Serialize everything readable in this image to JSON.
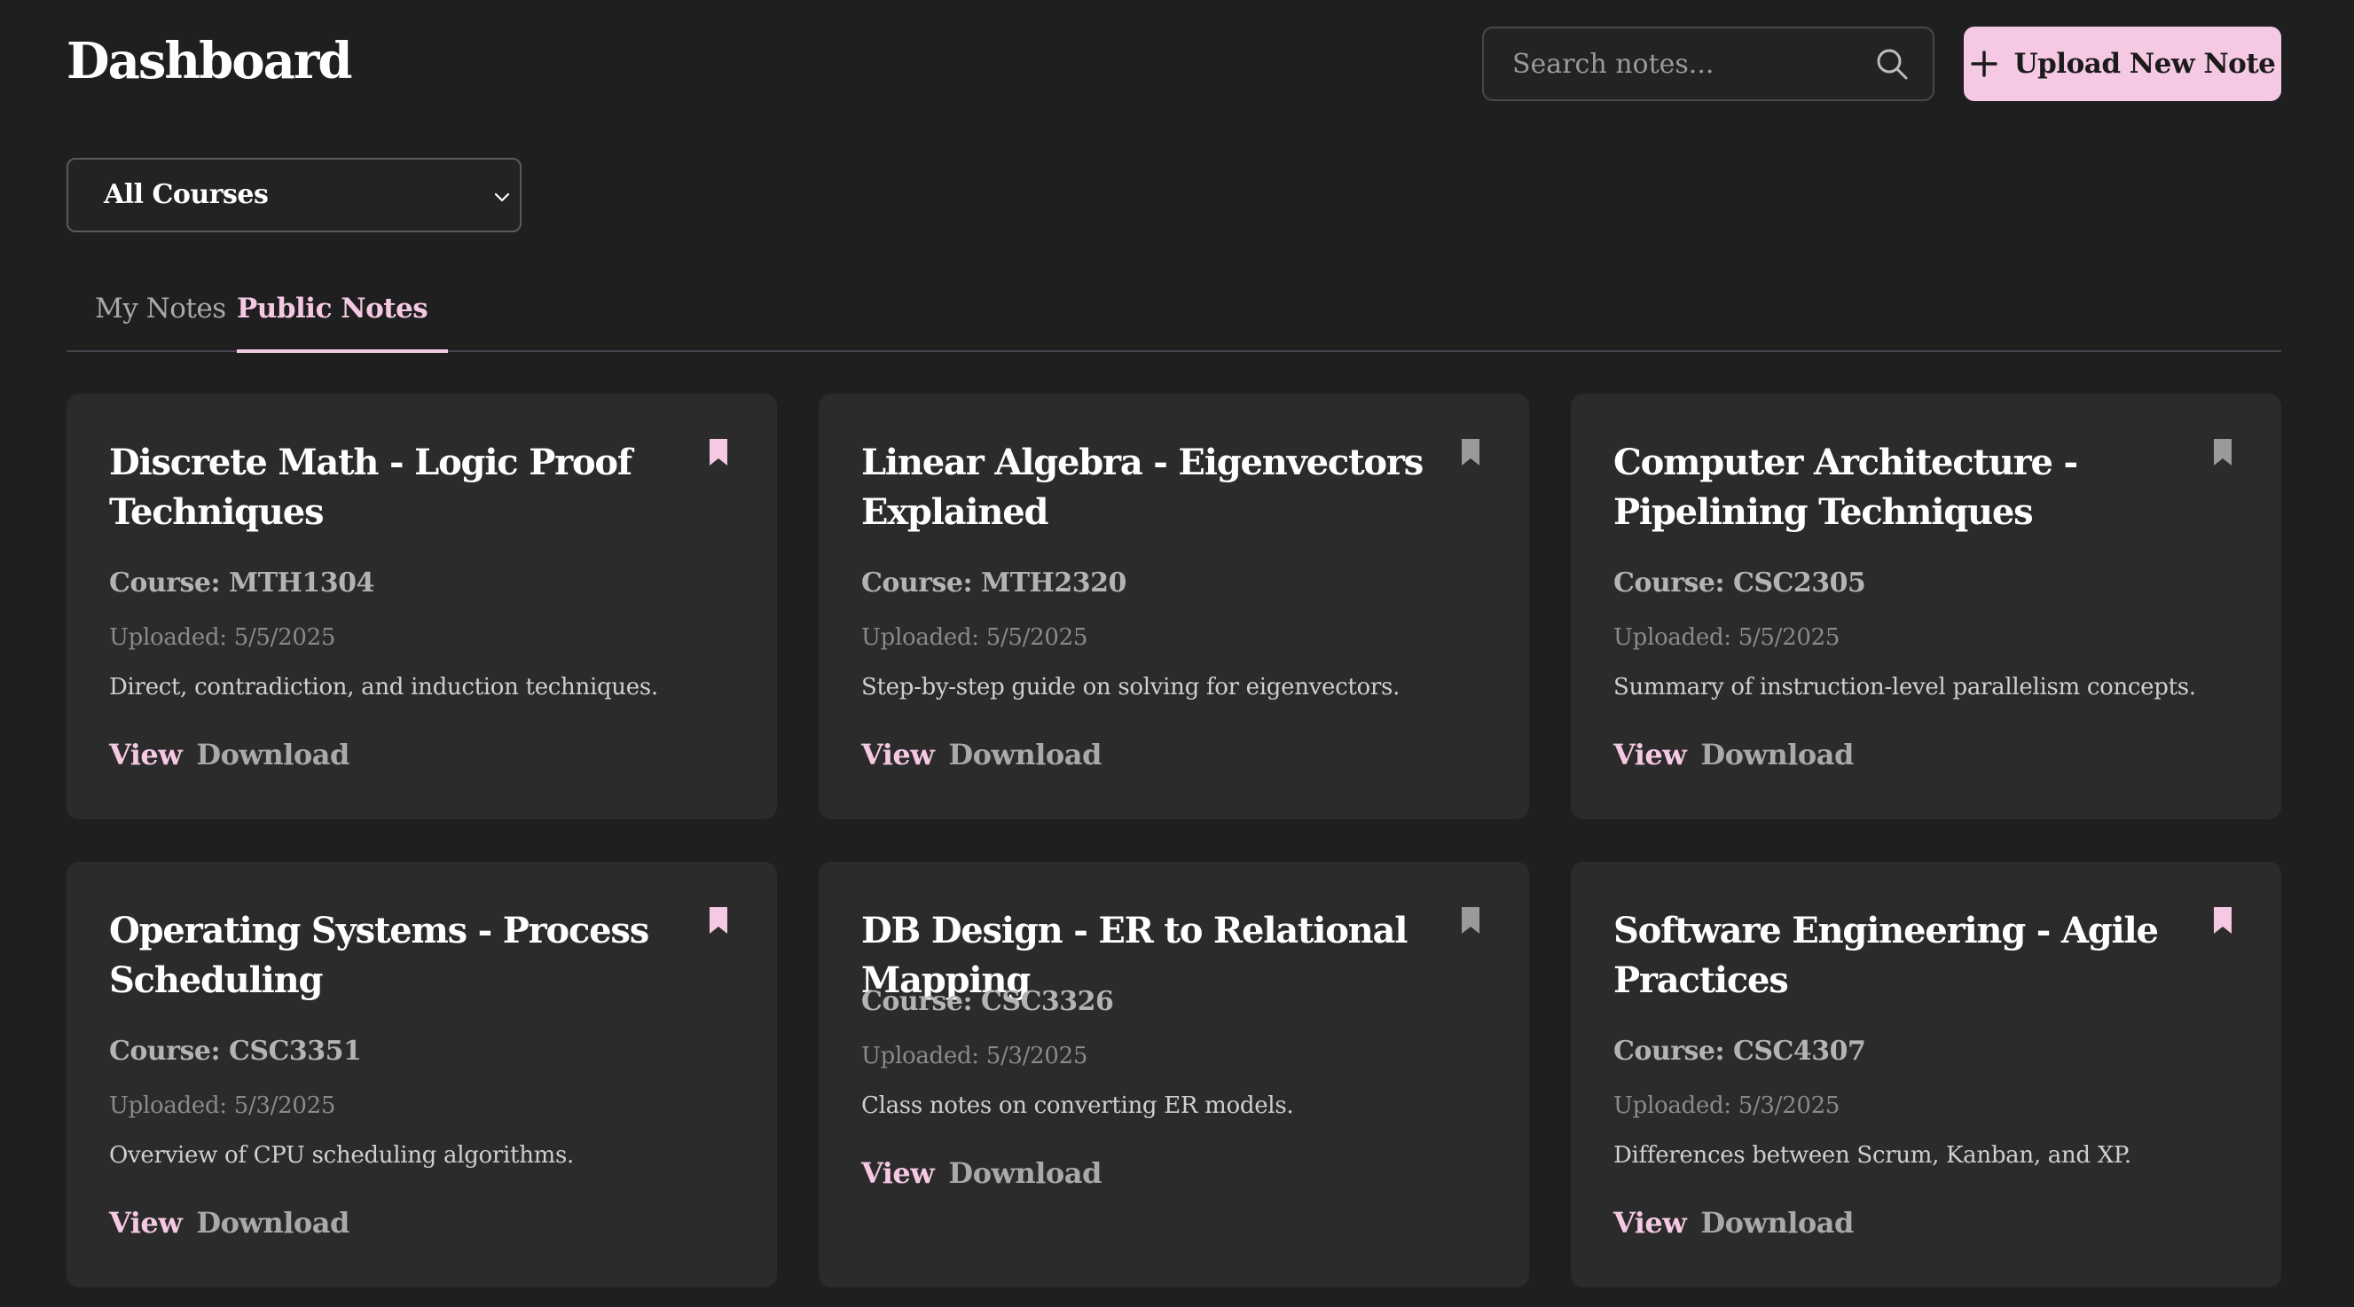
{
  "header": {
    "title": "Dashboard",
    "search_placeholder": "Search notes...",
    "upload_label": "Upload New Note"
  },
  "filter": {
    "selected": "All Courses"
  },
  "tabs": [
    {
      "label": "My Notes",
      "active": false
    },
    {
      "label": "Public Notes",
      "active": true
    }
  ],
  "colors": {
    "accent": "#f5c8e3",
    "background": "#1f1f1f",
    "card": "#2b2b2b",
    "bookmark_saved": "#f5c8e3",
    "bookmark_unsaved": "#9a9a9a"
  },
  "notes": [
    {
      "title": "Discrete Math - Logic Proof Techniques",
      "course": "Course: MTH1304",
      "uploaded": "Uploaded: 5/5/2025",
      "description": "Direct, contradiction, and induction techniques.",
      "view": "View",
      "download": "Download",
      "bookmarked": true
    },
    {
      "title": "Linear Algebra - Eigenvectors Explained",
      "course": "Course: MTH2320",
      "uploaded": "Uploaded: 5/5/2025",
      "description": "Step-by-step guide on solving for eigenvectors.",
      "view": "View",
      "download": "Download",
      "bookmarked": false
    },
    {
      "title": "Computer Architecture - Pipelining Techniques",
      "course": "Course: CSC2305",
      "uploaded": "Uploaded: 5/5/2025",
      "description": "Summary of instruction-level parallelism concepts.",
      "view": "View",
      "download": "Download",
      "bookmarked": false
    },
    {
      "title": "Operating Systems - Process Scheduling",
      "course": "Course: CSC3351",
      "uploaded": "Uploaded: 5/3/2025",
      "description": "Overview of CPU scheduling algorithms.",
      "view": "View",
      "download": "Download",
      "bookmarked": true
    },
    {
      "title": "DB Design - ER to Relational Mapping",
      "course": "Course: CSC3326",
      "uploaded": "Uploaded: 5/3/2025",
      "description": "Class notes on converting ER models.",
      "view": "View",
      "download": "Download",
      "bookmarked": false
    },
    {
      "title": "Software Engineering - Agile Practices",
      "course": "Course: CSC4307",
      "uploaded": "Uploaded: 5/3/2025",
      "description": "Differences between Scrum, Kanban, and XP.",
      "view": "View",
      "download": "Download",
      "bookmarked": true
    }
  ]
}
